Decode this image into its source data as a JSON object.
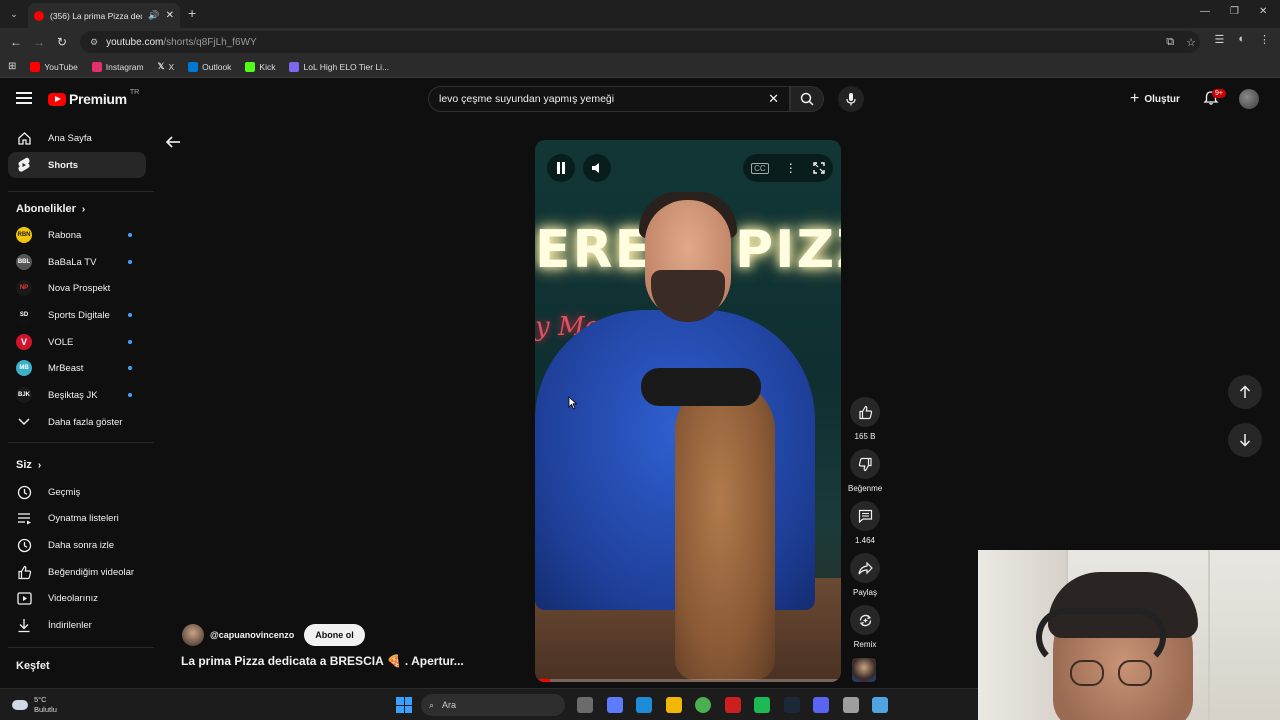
{
  "browser": {
    "tab_title": "(356) La prima Pizza dedica",
    "url_host": "youtube.com",
    "url_path": "/shorts/q8FjLh_f6WY",
    "bookmarks": [
      {
        "label": "YouTube",
        "color": "#ff0000"
      },
      {
        "label": "Instagram",
        "color": "#e1306c"
      },
      {
        "label": "X",
        "color": "#ffffff"
      },
      {
        "label": "Outlook",
        "color": "#0078d4"
      },
      {
        "label": "Kick",
        "color": "#53fc18"
      },
      {
        "label": "LoL High ELO Tier Li...",
        "color": "#7b68ee"
      }
    ]
  },
  "header": {
    "logo_text": "Premium",
    "logo_country": "TR",
    "search_value": "levo çeşme suyundan yapmış yemeği",
    "create_label": "Oluştur",
    "notification_badge": "9+"
  },
  "sidebar": {
    "main": [
      {
        "label": "Ana Sayfa"
      },
      {
        "label": "Shorts"
      }
    ],
    "subscriptions_title": "Abonelikler",
    "subscriptions": [
      {
        "label": "Rabona",
        "color": "#f2c40c",
        "text": "RBN"
      },
      {
        "label": "BaBaLa TV",
        "color": "#555555",
        "text": "BBL"
      },
      {
        "label": "Nova Prospekt",
        "color": "#1a1a1a",
        "text": "NP"
      },
      {
        "label": "Sports Digitale",
        "color": "#111111",
        "text": "SD"
      },
      {
        "label": "VOLE",
        "color": "#d0142c",
        "text": "V"
      },
      {
        "label": "MrBeast",
        "color": "#3bb1c9",
        "text": "MB"
      },
      {
        "label": "Beşiktaş JK",
        "color": "#1a1a1a",
        "text": "BJK"
      }
    ],
    "show_more": "Daha fazla göster",
    "you_title": "Siz",
    "you_items": [
      {
        "label": "Geçmiş"
      },
      {
        "label": "Oynatma listeleri"
      },
      {
        "label": "Daha sonra izle"
      },
      {
        "label": "Beğendiğim videolar"
      },
      {
        "label": "Videolarınız"
      },
      {
        "label": "İndirilenler"
      }
    ],
    "explore_title": "Keşfet"
  },
  "video": {
    "neon_left": "ERE",
    "neon_right": "PIZZ",
    "neon_script": "y Mo   co",
    "progress": 0.05
  },
  "actions": {
    "like_count": "165 B",
    "dislike_label": "Beğenme",
    "comment_count": "1.464",
    "share_label": "Paylaş",
    "remix_label": "Remix"
  },
  "channel": {
    "handle": "@capuanovincenzo",
    "subscribe_label": "Abone ol",
    "video_title": "La prima Pizza dedicata a BRESCIA 🍕 . Apertur..."
  },
  "taskbar": {
    "temperature": "5°C",
    "weather": "Bulutlu",
    "search_placeholder": "Ara",
    "apps": [
      "#6b6b6b",
      "#5b7cff",
      "#1e8bd6",
      "#f2b705",
      "#4caf50",
      "#cc1f1f",
      "#1db954",
      "#1b2838",
      "#5865f2",
      "#9e9e9e",
      "#4fa3e0"
    ]
  }
}
